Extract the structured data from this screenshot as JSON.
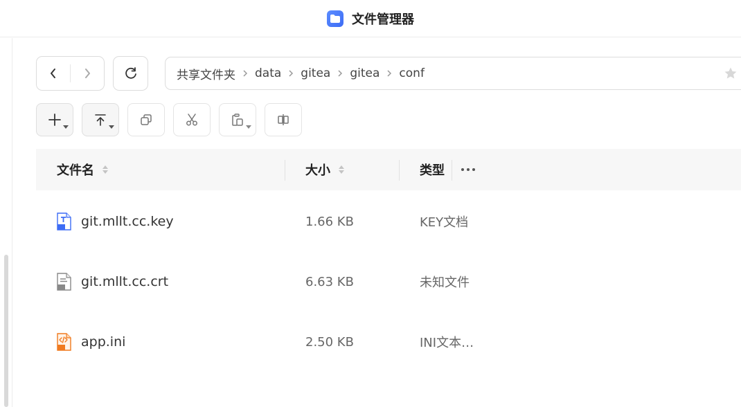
{
  "app": {
    "title": "文件管理器",
    "accent": "#3d6cf5"
  },
  "breadcrumb": [
    "共享文件夹",
    "data",
    "gitea",
    "gitea",
    "conf"
  ],
  "toolbar": {
    "icons": [
      "plus-icon",
      "upload-icon",
      "copy-icon",
      "scissors-icon",
      "paste-icon",
      "move-icon"
    ]
  },
  "table": {
    "headers": {
      "name": "文件名",
      "size": "大小",
      "type": "类型"
    },
    "rows": [
      {
        "name": "git.mllt.cc.key",
        "size": "1.66 KB",
        "type": "KEY文档",
        "icon": "key-file-icon"
      },
      {
        "name": "git.mllt.cc.crt",
        "size": "6.63 KB",
        "type": "未知文件",
        "icon": "unknown-file-icon"
      },
      {
        "name": "app.ini",
        "size": "2.50 KB",
        "type": "INI文本…",
        "icon": "ini-file-icon"
      }
    ]
  }
}
